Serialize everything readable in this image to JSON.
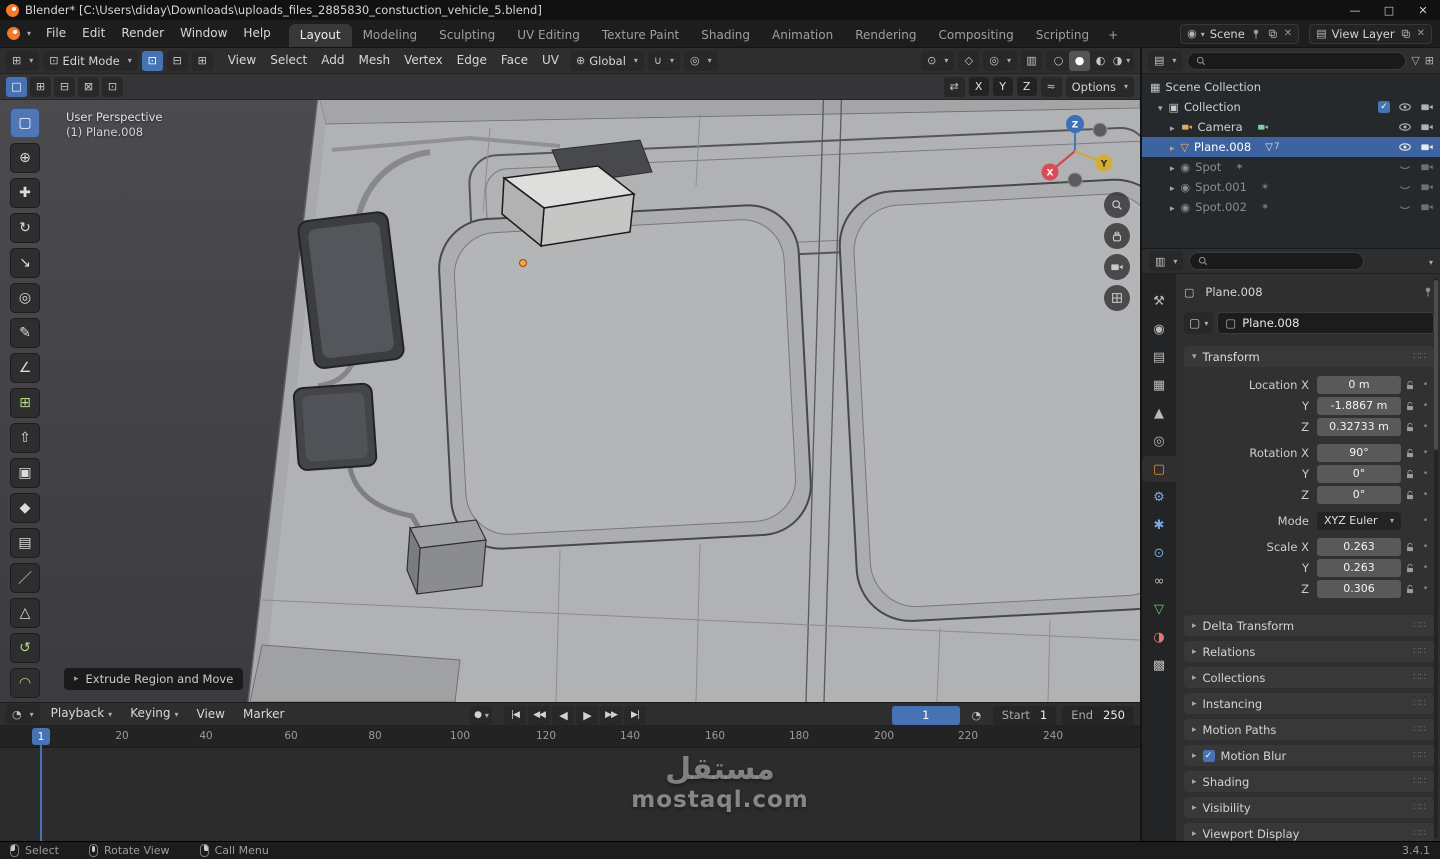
{
  "titlebar": {
    "title": "Blender* [C:\\Users\\diday\\Downloads\\uploads_files_2885830_constuction_vehicle_5.blend]"
  },
  "icons": {
    "minimize": "—",
    "maximize": "□",
    "close": "✕",
    "editor_3d_viewport": "⊞",
    "editor_timeline": "◔",
    "editor_outliner": "▤",
    "editor_properties": "▥",
    "vertex_mode": "⊡",
    "edge_mode": "⊟",
    "face_mode": "⊞",
    "orientation_globe": "⊕",
    "snap_magnet": "∪",
    "proportional_circle": "◎",
    "active_tool_sphere": "⊙",
    "gizmo_toggle": "◇",
    "overlays_toggle": "◎",
    "xray_toggle": "▥",
    "shading_wireframe": "○",
    "shading_solid": "●",
    "shading_material": "◐",
    "shading_rendered": "◑",
    "select_new": "□",
    "select_extend": "⊞",
    "select_subtract": "⊟",
    "select_invert": "⊠",
    "select_intersect": "⊡",
    "mirror": "⇄",
    "falloff": "≈",
    "scene": "◉",
    "view_layer": "▤",
    "check": "✓",
    "scene_collection": "▦",
    "collection": "▣",
    "mesh_object": "▽",
    "mesh_data": "▽",
    "light_object": "◉",
    "light_badge": "✶",
    "filter": "▽",
    "new_collection": "⊞",
    "object_chip": "▢",
    "autokey": "●",
    "clock": "◔"
  },
  "topbar": {
    "menus": [
      "File",
      "Edit",
      "Render",
      "Window",
      "Help"
    ],
    "tabs": [
      "Layout",
      "Modeling",
      "Sculpting",
      "UV Editing",
      "Texture Paint",
      "Shading",
      "Animation",
      "Rendering",
      "Compositing",
      "Scripting"
    ],
    "add_tab": "+",
    "scene": {
      "label": "Scene"
    },
    "view_layer": {
      "label": "View Layer"
    }
  },
  "viewport_header": {
    "mode": "Edit Mode",
    "menus": [
      "View",
      "Select",
      "Add",
      "Mesh",
      "Vertex",
      "Edge",
      "Face",
      "UV"
    ],
    "orientation": "Global"
  },
  "tool_settings": {
    "axis": [
      "X",
      "Y",
      "Z"
    ],
    "options_label": "Options"
  },
  "toolbar": {
    "tools": [
      {
        "name": "tweak-select",
        "glyph": "▢"
      },
      {
        "name": "cursor",
        "glyph": "⊕"
      },
      {
        "name": "move",
        "glyph": "✚"
      },
      {
        "name": "rotate",
        "glyph": "↻"
      },
      {
        "name": "scale",
        "glyph": "↘"
      },
      {
        "name": "transform",
        "glyph": "◎"
      },
      {
        "name": "annotate",
        "glyph": "✎"
      },
      {
        "name": "measure",
        "glyph": "∠"
      },
      {
        "name": "add-cube",
        "glyph": "⊞"
      },
      {
        "name": "extrude-region",
        "glyph": "⇧"
      },
      {
        "name": "inset-faces",
        "glyph": "▣"
      },
      {
        "name": "bevel",
        "glyph": "◆"
      },
      {
        "name": "loop-cut",
        "glyph": "▤"
      },
      {
        "name": "knife",
        "glyph": "／"
      },
      {
        "name": "poly-build",
        "glyph": "△"
      },
      {
        "name": "spin",
        "glyph": "↺"
      },
      {
        "name": "smooth",
        "glyph": "◠"
      }
    ]
  },
  "viewport": {
    "perspective_label": "User Perspective",
    "object_label": "(1) Plane.008",
    "operator_panel": "Extrude Region and Move",
    "gizmo_axes": [
      "X",
      "Y",
      "Z"
    ]
  },
  "timeline": {
    "menus": [
      "Playback",
      "Keying",
      "View",
      "Marker"
    ],
    "transport": {
      "jump_start": "|◀",
      "prev_key": "◀◀",
      "play_back": "◀",
      "play": "▶",
      "next_key": "▶▶",
      "jump_end": "▶|"
    },
    "current_frame": "1",
    "start_label": "Start",
    "start_value": "1",
    "end_label": "End",
    "end_value": "250",
    "ticks": [
      "20",
      "40",
      "60",
      "80",
      "100",
      "120",
      "140",
      "160",
      "180",
      "200",
      "220",
      "240"
    ]
  },
  "outliner": {
    "rows": [
      {
        "label": "Scene Collection"
      },
      {
        "label": "Collection"
      },
      {
        "label": "Camera"
      },
      {
        "label": "Plane.008",
        "badge": "7"
      },
      {
        "label": "Spot"
      },
      {
        "label": "Spot.001"
      },
      {
        "label": "Spot.002"
      }
    ]
  },
  "properties": {
    "breadcrumb_object": "Plane.008",
    "name_field": "Plane.008",
    "tabs": [
      {
        "name": "tool",
        "glyph": "⚒"
      },
      {
        "name": "render",
        "glyph": "◉"
      },
      {
        "name": "output",
        "glyph": "▤"
      },
      {
        "name": "view-layer",
        "glyph": "▦"
      },
      {
        "name": "scene",
        "glyph": "▲"
      },
      {
        "name": "world",
        "glyph": "◎"
      },
      {
        "name": "object",
        "glyph": "▢"
      },
      {
        "name": "modifiers",
        "glyph": "⚙"
      },
      {
        "name": "particles",
        "glyph": "✱"
      },
      {
        "name": "physics",
        "glyph": "⊙"
      },
      {
        "name": "constraints",
        "glyph": "∞"
      },
      {
        "name": "object-data",
        "glyph": "▽"
      },
      {
        "name": "material",
        "glyph": "◑"
      },
      {
        "name": "texture",
        "glyph": "▩"
      }
    ],
    "transform": {
      "title": "Transform",
      "rows": [
        {
          "label": "Location X",
          "value": "0 m"
        },
        {
          "label": "Y",
          "value": "-1.8867 m"
        },
        {
          "label": "Z",
          "value": "0.32733 m"
        },
        {
          "label": "Rotation X",
          "value": "90°"
        },
        {
          "label": "Y",
          "value": "0°"
        },
        {
          "label": "Z",
          "value": "0°"
        },
        {
          "label": "Mode",
          "value": "XYZ Euler"
        },
        {
          "label": "Scale X",
          "value": "0.263"
        },
        {
          "label": "Y",
          "value": "0.263"
        },
        {
          "label": "Z",
          "value": "0.306"
        }
      ]
    },
    "sections": [
      "Delta Transform",
      "Relations",
      "Collections",
      "Instancing",
      "Motion Paths",
      "Motion Blur",
      "Shading",
      "Visibility",
      "Viewport Display"
    ]
  },
  "statusbar": {
    "items": [
      "Select",
      "Rotate View",
      "Call Menu"
    ],
    "version": "3.4.1"
  },
  "watermark": {
    "line1": "مستقل",
    "line2": "mostaql.com"
  },
  "colors": {
    "accent": "#4772b3",
    "selection": "#3d63a0",
    "object_orange": "#e8913c",
    "axis_x": "#d94b55",
    "axis_y": "#d6ab36",
    "axis_z": "#3d6fb4"
  }
}
